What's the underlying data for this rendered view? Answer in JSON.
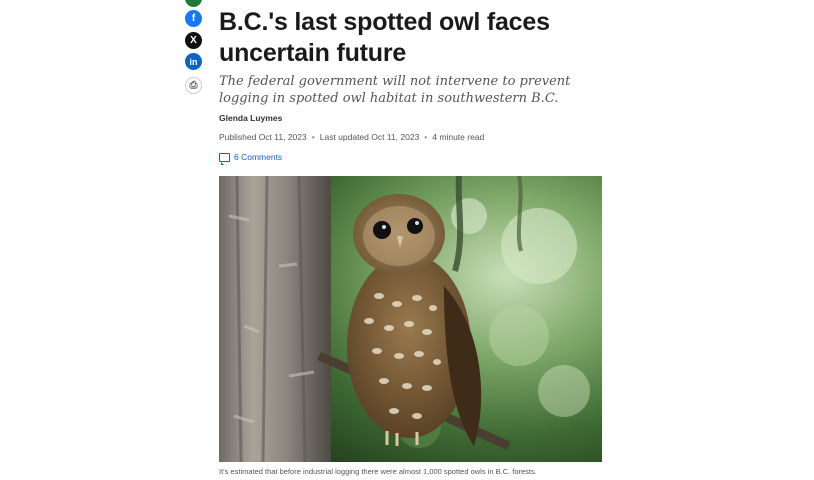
{
  "share": {
    "facebook_glyph": "f",
    "x_glyph": "X",
    "linkedin_glyph": "in",
    "print_glyph": "⎙"
  },
  "article": {
    "headline": "B.C.'s last spotted owl faces uncertain future",
    "deck": "The federal government will not intervene to prevent logging in spotted owl habitat in southwestern B.C.",
    "author": "Glenda Luymes",
    "published": "Published Oct 11, 2023",
    "updated": "Last updated Oct 11, 2023",
    "read_time": "4 minute read",
    "separator": "•",
    "comments_label": "6 Comments",
    "image_caption": "It's estimated that before industrial logging there were almost 1,000 spotted owls in B.C. forests."
  },
  "colors": {
    "facebook": "#1877f2",
    "x": "#111111",
    "linkedin": "#0a66c2",
    "link": "#1a5fb4"
  }
}
